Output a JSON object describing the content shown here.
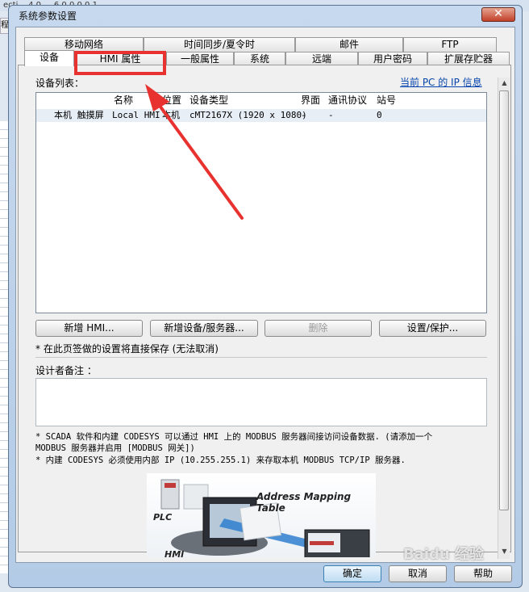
{
  "background": {
    "title_fragment": "ecti... 4.0 ... 6.0.0.0.0.1",
    "menu_fragment": "程文"
  },
  "dialog": {
    "title": "系统参数设置",
    "close_glyph": "✕"
  },
  "tabs": {
    "top_row": [
      "移动网络",
      "时间同步/夏令时",
      "邮件",
      "FTP"
    ],
    "bottom_row": [
      "设备",
      "HMI 属性",
      "一般属性",
      "系统",
      "远端",
      "用户密码",
      "扩展存贮器"
    ]
  },
  "device_list": {
    "label": "设备列表：",
    "ip_link": "当前 PC 的 IP 信息",
    "columns": [
      "名称",
      "位置",
      "设备类型",
      "界面",
      "通讯协议",
      "站号"
    ],
    "rows": [
      [
        "本机 触摸屏",
        "Local HMI",
        "本机",
        "cMT2167X (1920 x 1080)",
        "-",
        "-",
        "0"
      ]
    ]
  },
  "buttons": {
    "add_hmi": "新增 HMI...",
    "add_device": "新增设备/服务器...",
    "delete": "删除",
    "settings": "设置/保护..."
  },
  "notice_save": "* 在此页签做的设置将直接保存 (无法取消)",
  "designer_notes_label": "设计者备注 ：",
  "notes": [
    "* SCADA 软件和内建 CODESYS 可以通过 HMI 上的 MODBUS 服务器间接访问设备数据. (请添加一个",
    "MODBUS 服务器并启用 [MODBUS 网关])",
    "* 内建 CODESYS 必须使用内部 IP (10.255.255.1) 来存取本机 MODBUS TCP/IP 服务器."
  ],
  "illustration": {
    "title": "Address Mapping Table",
    "plc": "PLC",
    "hmi": "HMI"
  },
  "footer": {
    "ok": "确定",
    "cancel": "取消",
    "help": "帮助"
  },
  "watermark": "Baidu 经验",
  "colors": {
    "highlight": "#e8322f",
    "link": "#0645ad"
  }
}
